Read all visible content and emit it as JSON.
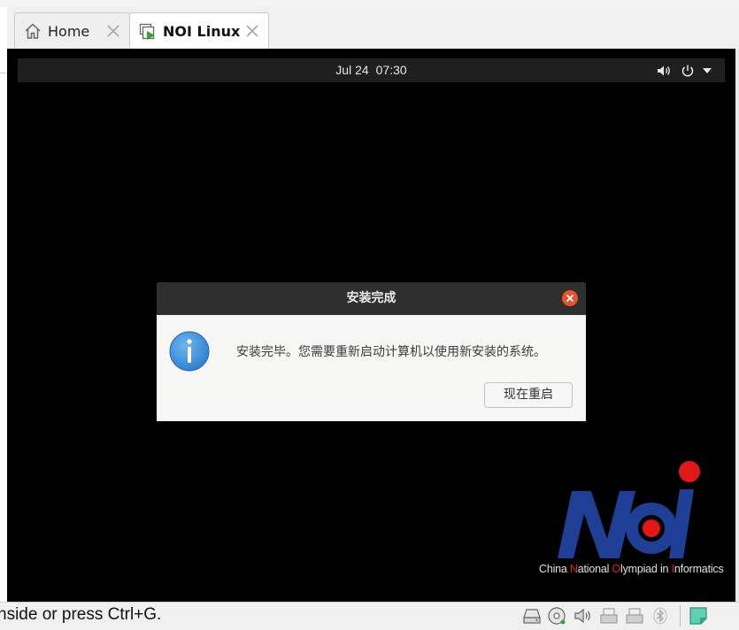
{
  "tabs": [
    {
      "label": "Home",
      "icon": "home-icon"
    },
    {
      "label": "NOI Linux",
      "icon": "vm-display-icon",
      "active": true
    }
  ],
  "guest": {
    "top_bar": {
      "date": "Jul 24",
      "time": "07:30"
    },
    "tray_icons": [
      "volume-icon",
      "power-icon",
      "dropdown-arrow-icon"
    ]
  },
  "dialog": {
    "title": "安装完成",
    "message": "安装完毕。您需要重新启动计算机以使用新安装的系统。",
    "button_label": "现在重启",
    "info_icon": "info-icon"
  },
  "logo": {
    "letters": "NOI",
    "tagline_parts": [
      "China ",
      "N",
      "ational ",
      "O",
      "lympiad in ",
      "I",
      "nformatics"
    ]
  },
  "statusbar": {
    "hint_text": "nside or press Ctrl+G.",
    "icons": [
      "hard-disk-icon",
      "optical-drive-icon",
      "audio-icon",
      "usb-icon",
      "usb-icon",
      "bluetooth-icon",
      "sticky-note-icon"
    ]
  },
  "colors": {
    "dialog_header": "#2f2f2f",
    "close_button": "#e5532d",
    "info_blue": "#3b8ed8",
    "logo_blue": "#1f3f96",
    "logo_red": "#e01818"
  }
}
